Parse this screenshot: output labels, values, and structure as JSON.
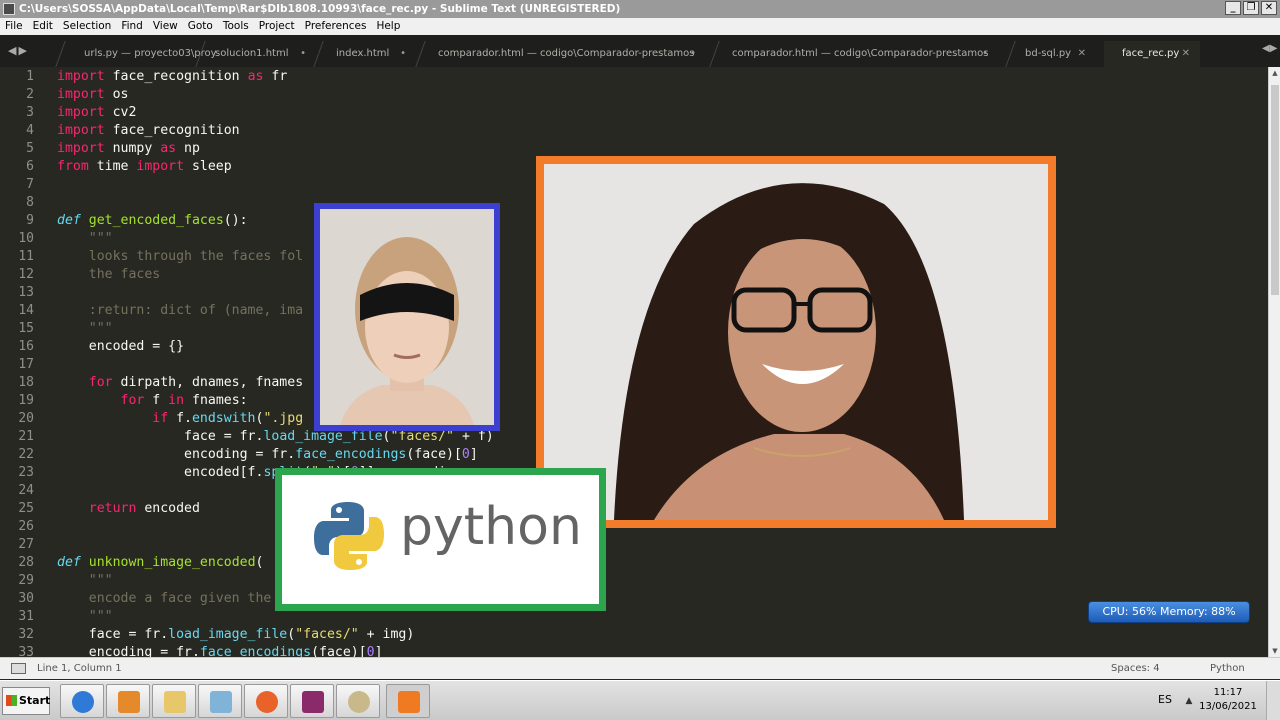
{
  "window": {
    "title": "C:\\Users\\SOSSA\\AppData\\Local\\Temp\\Rar$DIb1808.10993\\face_rec.py - Sublime Text (UNREGISTERED)",
    "controls": [
      "_",
      "❐",
      "✕"
    ]
  },
  "menu": [
    "File",
    "Edit",
    "Selection",
    "Find",
    "View",
    "Goto",
    "Tools",
    "Project",
    "Preferences",
    "Help"
  ],
  "tabs": [
    {
      "label": "urls.py — proyecto03\\proy",
      "close": ""
    },
    {
      "label": "solucion1.html",
      "close": "•"
    },
    {
      "label": "index.html",
      "close": "•"
    },
    {
      "label": "comparador.html — codigo\\Comparador-prestamos",
      "close": "•"
    },
    {
      "label": "comparador.html — codigo\\Comparador-prestamos",
      "close": "•"
    },
    {
      "label": "bd-sql.py",
      "close": "✕"
    },
    {
      "label": "face_rec.py",
      "close": "✕",
      "active": true
    }
  ],
  "editor": {
    "line_numbers": [
      "1",
      "2",
      "3",
      "4",
      "5",
      "6",
      "7",
      "8",
      "9",
      "10",
      "11",
      "12",
      "13",
      "14",
      "15",
      "16",
      "17",
      "18",
      "19",
      "20",
      "21",
      "22",
      "23",
      "24",
      "25",
      "26",
      "27",
      "28",
      "29",
      "30",
      "31",
      "32",
      "33"
    ]
  },
  "overlays": {
    "python_logo_text": "python"
  },
  "cpu_widget": "CPU: 56%  Memory: 88%",
  "status": {
    "position": "Line 1, Column 1",
    "spaces": "Spaces: 4",
    "syntax": "Python"
  },
  "taskbar": {
    "start": "Start",
    "lang": "ES",
    "time": "11:17",
    "date": "13/06/2021"
  },
  "colors": {
    "editor_bg": "#272822",
    "keyword": "#f92672",
    "function": "#a6e22e",
    "string": "#e6db74",
    "comment": "#75715e",
    "number": "#ae81ff",
    "storage": "#66d9ef",
    "small_photo_border": "#3c3fcf",
    "big_photo_border": "#f37c2a",
    "python_border": "#2da44e"
  }
}
